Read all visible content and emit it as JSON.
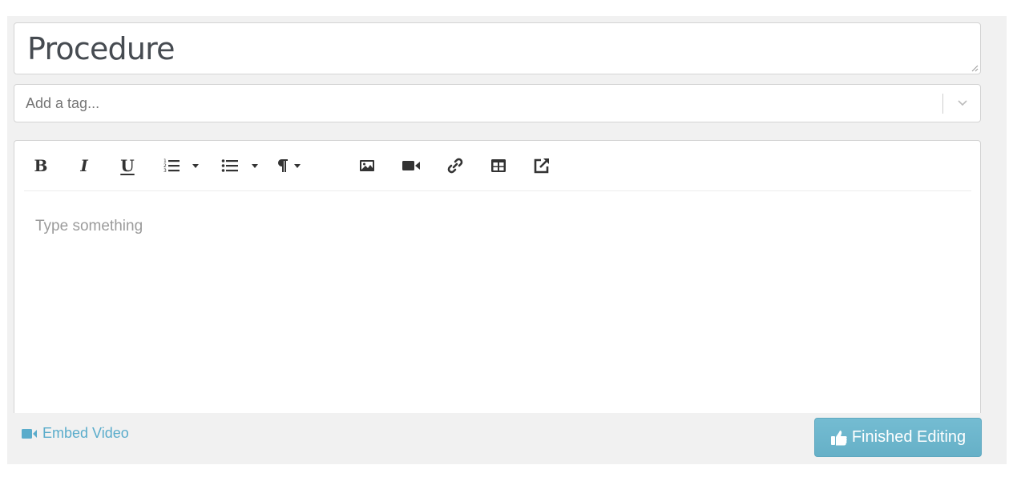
{
  "title_field": {
    "value": "Procedure"
  },
  "tag_field": {
    "placeholder": "Add a tag..."
  },
  "editor": {
    "placeholder": "Type something",
    "toolbar": {
      "bold": "B",
      "italic": "I",
      "underline": "U",
      "buttons": [
        "bold",
        "italic",
        "underline",
        "ordered-list",
        "unordered-list",
        "paragraph",
        "image",
        "video",
        "link",
        "table",
        "external-link"
      ]
    }
  },
  "footer": {
    "embed_video_label": "Embed Video",
    "finished_label": "Finished Editing"
  },
  "colors": {
    "accent": "#5aaccb",
    "button_bg": "#6cb6cc",
    "panel_bg": "#f1f1f1"
  }
}
